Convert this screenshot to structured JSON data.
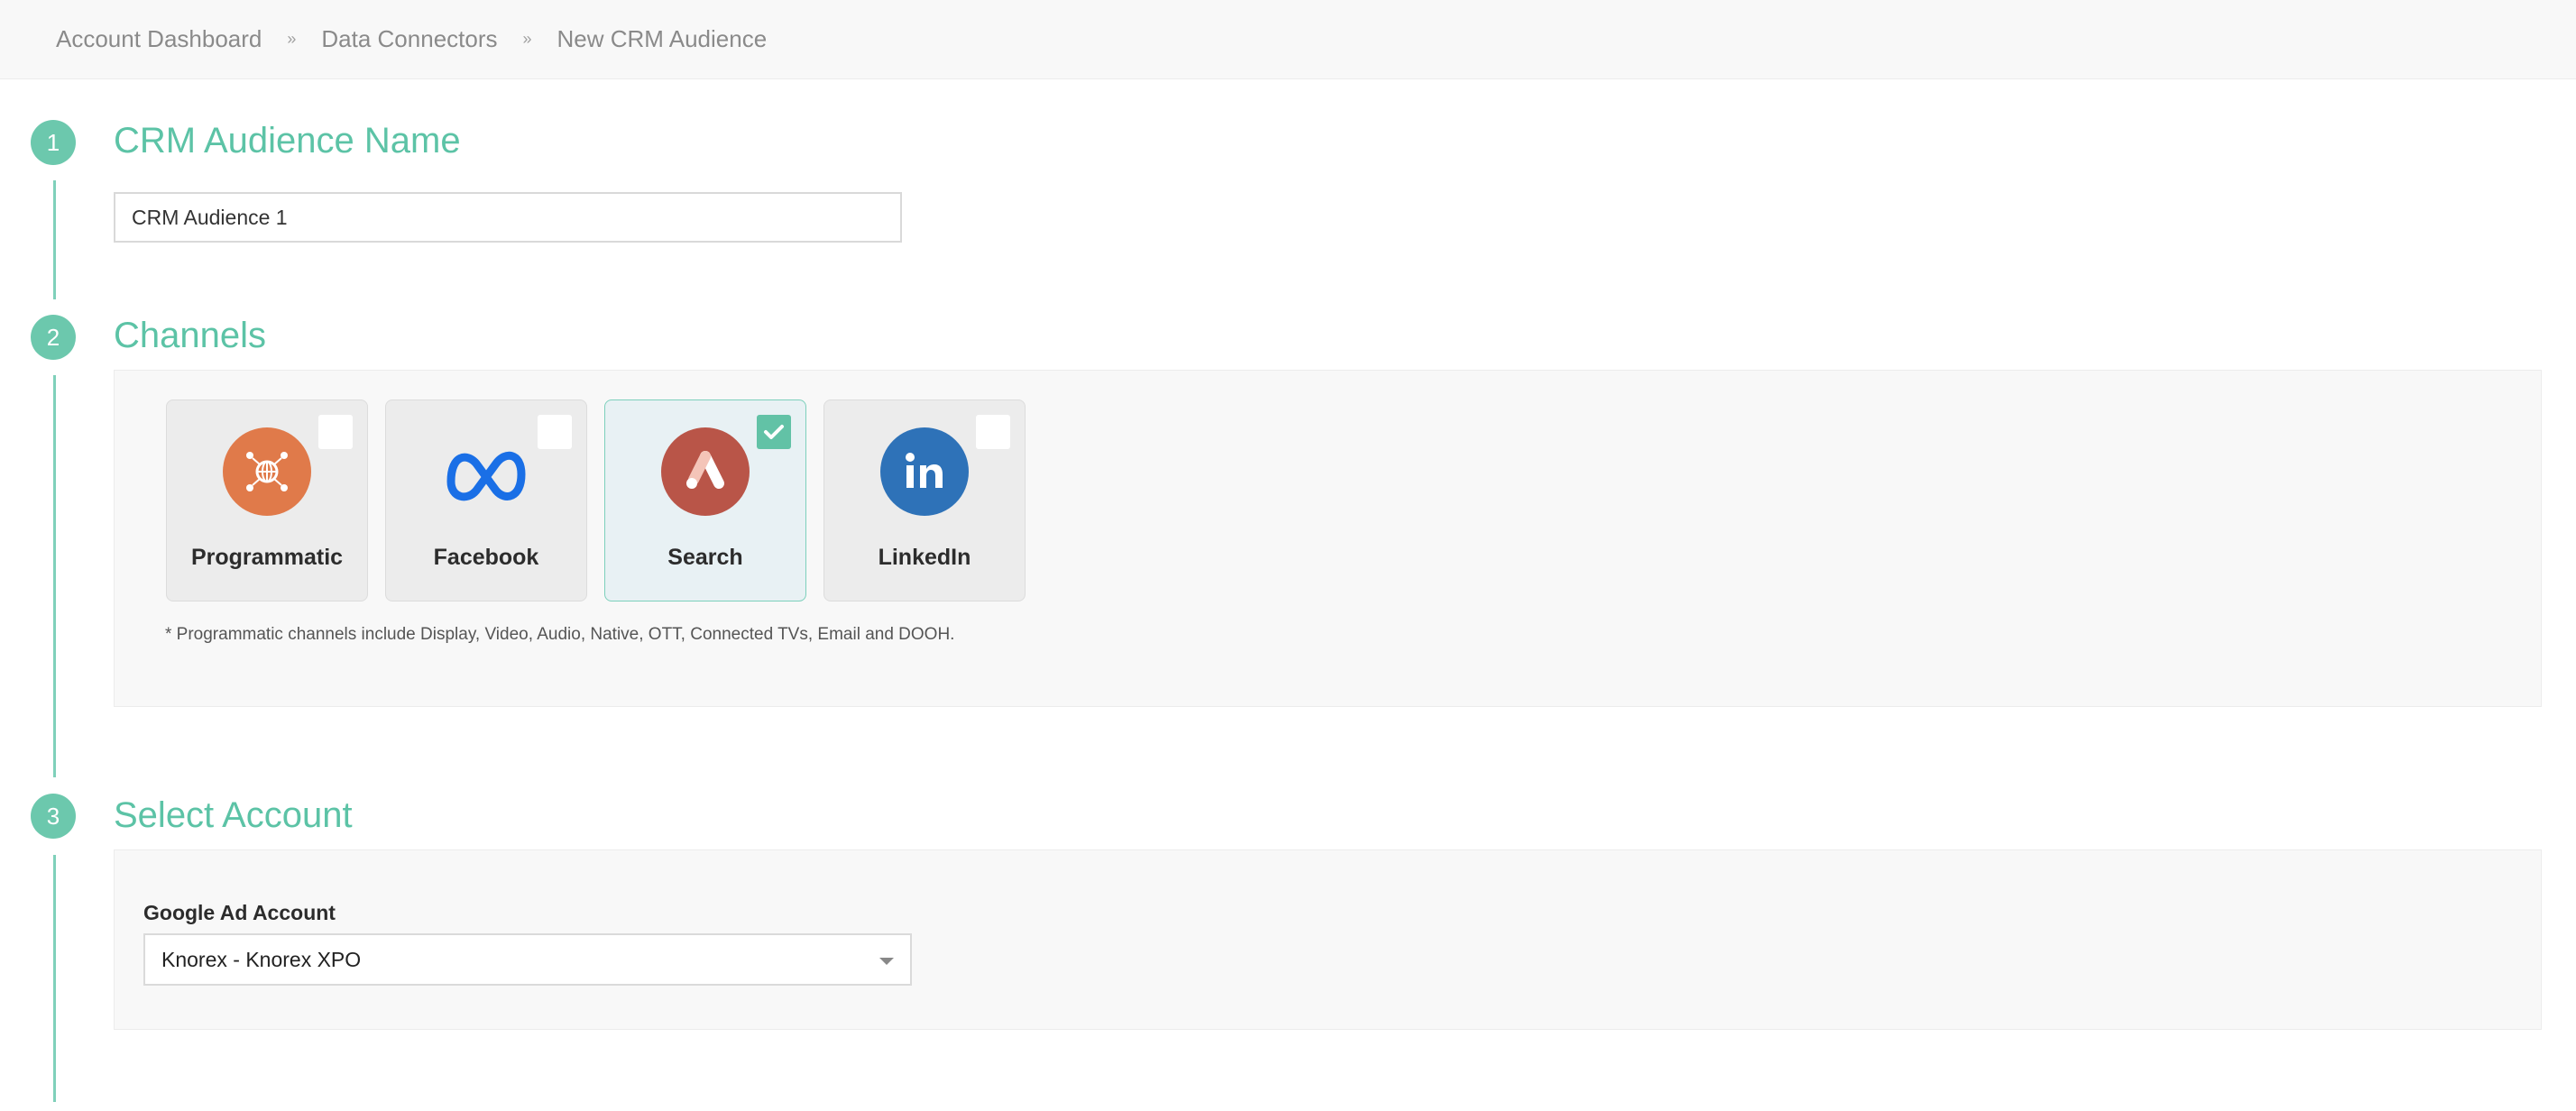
{
  "breadcrumb": {
    "items": [
      "Account Dashboard",
      "Data Connectors",
      "New CRM Audience"
    ],
    "separator": "»"
  },
  "steps": [
    {
      "number": "1",
      "title": "CRM Audience Name"
    },
    {
      "number": "2",
      "title": "Channels"
    },
    {
      "number": "3",
      "title": "Select Account"
    }
  ],
  "audience_name": {
    "value": "CRM Audience 1"
  },
  "channels": {
    "items": [
      {
        "label": "Programmatic",
        "icon": "programmatic-icon",
        "selected": false,
        "color": "#e07a4a"
      },
      {
        "label": "Facebook",
        "icon": "meta-icon",
        "selected": false,
        "color": "#1877f2"
      },
      {
        "label": "Search",
        "icon": "google-ads-icon",
        "selected": true,
        "color": "#b95548"
      },
      {
        "label": "LinkedIn",
        "icon": "linkedin-icon",
        "selected": false,
        "color": "#2e72b8"
      }
    ],
    "note": "* Programmatic channels include Display, Video, Audio, Native, OTT, Connected TVs, Email and DOOH."
  },
  "account": {
    "label": "Google Ad Account",
    "selected": "Knorex - Knorex XPO"
  },
  "colors": {
    "accent": "#6cc8ad",
    "title": "#5cc3a6"
  }
}
